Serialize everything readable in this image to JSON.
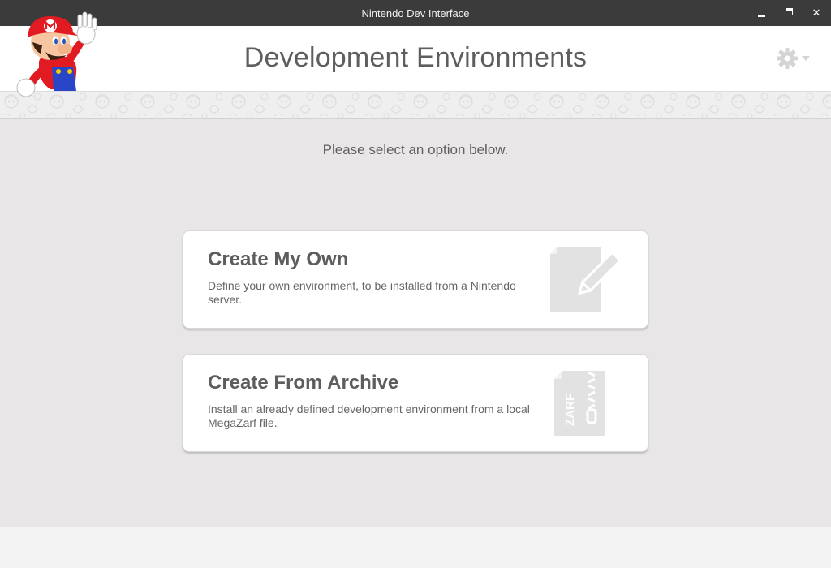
{
  "window": {
    "title": "Nintendo Dev Interface",
    "minimize_icon": "minimize-icon",
    "maximize_icon": "maximize-icon",
    "close_glyph": "✕"
  },
  "header": {
    "heading": "Development Environments",
    "mascot": "mario-mascot",
    "settings_icon": "gear-icon"
  },
  "main": {
    "prompt": "Please select an option below.",
    "options": [
      {
        "title": "Create My Own",
        "description": "Define your own environment, to be installed from a Nintendo server.",
        "icon": "document-pencil-icon"
      },
      {
        "title": "Create From Archive",
        "description": "Install an already defined development environment from a local MegaZarf file.",
        "icon": "zarf-archive-icon",
        "icon_text": "ZARF"
      }
    ]
  },
  "colors": {
    "titlebar": "#3b3b3b",
    "background": "#e8e6e6",
    "card": "#ffffff",
    "text": "#5e5e5e",
    "icon": "#e0e0e0"
  }
}
